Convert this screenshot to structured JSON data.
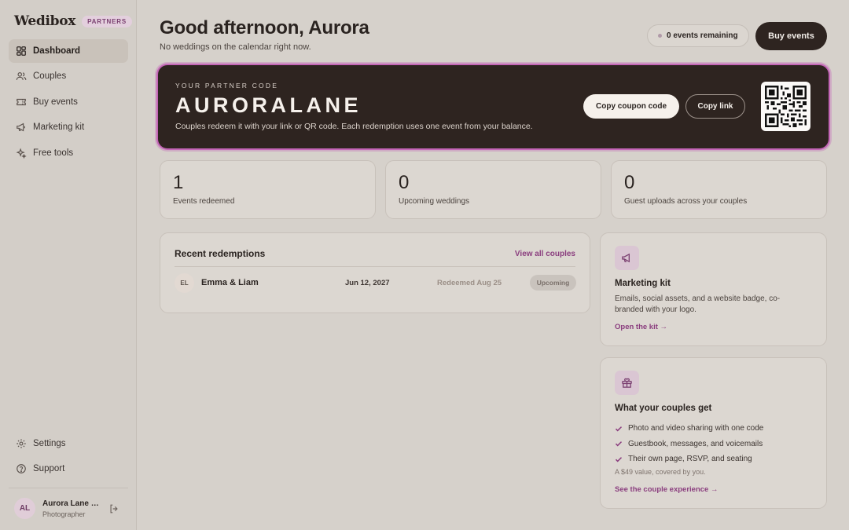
{
  "sidebar": {
    "logo": "Wedibox",
    "badge": "PARTNERS",
    "items": [
      {
        "label": "Dashboard",
        "icon": "dashboard-icon"
      },
      {
        "label": "Couples",
        "icon": "users-icon"
      },
      {
        "label": "Buy events",
        "icon": "ticket-icon"
      },
      {
        "label": "Marketing kit",
        "icon": "megaphone-icon"
      },
      {
        "label": "Free tools",
        "icon": "sparkles-icon"
      }
    ],
    "bottom_items": [
      {
        "label": "Settings",
        "icon": "gear-icon"
      },
      {
        "label": "Support",
        "icon": "help-icon"
      }
    ],
    "user": {
      "initials": "AL",
      "name": "Aurora Lane P...",
      "role": "Photographer"
    }
  },
  "header": {
    "greeting": "Good afternoon, Aurora",
    "subtitle": "No weddings on the calendar right now.",
    "remaining": "0 events remaining",
    "buy_button": "Buy events"
  },
  "partner_code": {
    "kicker": "YOUR PARTNER CODE",
    "code": "AURORALANE",
    "description": "Couples redeem it with your link or QR code. Each redemption uses one event from your balance.",
    "copy_code_button": "Copy coupon code",
    "copy_link_button": "Copy link"
  },
  "stats": [
    {
      "value": "1",
      "label": "Events redeemed"
    },
    {
      "value": "0",
      "label": "Upcoming weddings"
    },
    {
      "value": "0",
      "label": "Guest uploads across your couples"
    }
  ],
  "recent": {
    "title": "Recent redemptions",
    "view_all": "View all couples",
    "rows": [
      {
        "initials": "EL",
        "name": "Emma & Liam",
        "date": "Jun 12, 2027",
        "redeemed": "Redeemed Aug 25",
        "status": "Upcoming"
      }
    ]
  },
  "marketing": {
    "title": "Marketing kit",
    "description": "Emails, social assets, and a website badge, co-branded with your logo.",
    "link": "Open the kit →"
  },
  "couples_get": {
    "title": "What your couples get",
    "items": [
      "Photo and video sharing with one code",
      "Guestbook, messages, and voicemails",
      "Their own page, RSVP, and seating"
    ],
    "note": "A $49 value, covered by you.",
    "link": "See the couple experience →"
  },
  "colors": {
    "accent": "#8a3d7e",
    "dark": "#2e2420",
    "highlight_ring": "#c466b7"
  }
}
